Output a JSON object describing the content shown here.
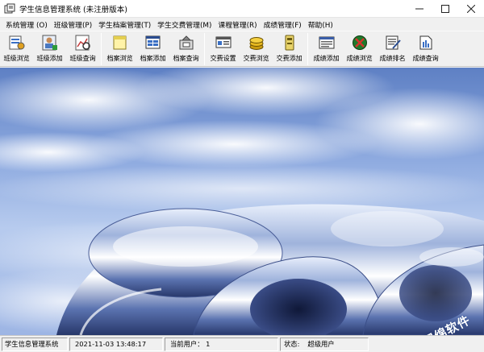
{
  "window": {
    "title": "学生信息管理系统 (未注册版本)",
    "controls": [
      "minimize",
      "maximize",
      "close"
    ]
  },
  "menu": [
    {
      "label": "系统管理 (O)"
    },
    {
      "label": "班级管理(P)"
    },
    {
      "label": "学生档案管理(T)"
    },
    {
      "label": "学生交费管理(M)"
    },
    {
      "label": "课程管理(R)"
    },
    {
      "label": "成绩管理(F)"
    },
    {
      "label": "帮助(H)"
    }
  ],
  "toolbar": {
    "groups": [
      [
        {
          "label": "班级浏览",
          "icon": "class-browse-icon"
        },
        {
          "label": "班级添加",
          "icon": "class-add-icon"
        },
        {
          "label": "班级查询",
          "icon": "class-query-icon"
        }
      ],
      [
        {
          "label": "档案浏览",
          "icon": "archive-browse-icon"
        },
        {
          "label": "档案添加",
          "icon": "archive-add-icon"
        },
        {
          "label": "档案查询",
          "icon": "archive-query-icon"
        }
      ],
      [
        {
          "label": "交费设置",
          "icon": "fee-settings-icon"
        },
        {
          "label": "交费浏览",
          "icon": "fee-browse-icon"
        },
        {
          "label": "交费添加",
          "icon": "fee-add-icon"
        }
      ],
      [
        {
          "label": "成绩添加",
          "icon": "score-add-icon"
        },
        {
          "label": "成绩浏览",
          "icon": "score-browse-icon"
        },
        {
          "label": "成绩排名",
          "icon": "score-rank-icon"
        },
        {
          "label": "成绩查询",
          "icon": "score-query-icon"
        }
      ]
    ]
  },
  "statusbar": {
    "app_name": "学生信息管理系统",
    "datetime": "2021-11-03 13:48:17",
    "current_users": "当前用户： 1",
    "status_label": "状态:",
    "status_value": "超级用户"
  },
  "watermark": {
    "text": "润绵软件"
  },
  "colors": {
    "sky_top": "#6f8ec9",
    "sky_bottom": "#b8cdee",
    "chrome": "#c9d6ee"
  }
}
